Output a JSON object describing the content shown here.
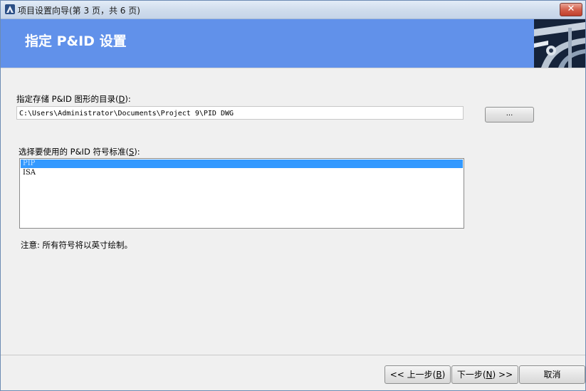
{
  "window": {
    "title": "项目设置向导(第 3 页，共 6 页)",
    "close_glyph": "✕"
  },
  "banner": {
    "heading": "指定 P&ID 设置"
  },
  "directory": {
    "label": "指定存储 P&ID 图形的目录",
    "hotkey": "D",
    "value": "C:\\Users\\Administrator\\Documents\\Project 9\\PID DWG",
    "browse_label": "..."
  },
  "standard": {
    "label": "选择要使用的 P&ID 符号标准",
    "hotkey": "S",
    "options": [
      "PIP",
      "ISA"
    ],
    "selected": "PIP"
  },
  "note": "注意: 所有符号将以英寸绘制。",
  "buttons": {
    "back_label": "<< 上一步",
    "back_hotkey": "B",
    "next_label": "下一步",
    "next_hotkey": "N",
    "next_suffix": ">>",
    "cancel_label": "取消"
  },
  "colors": {
    "banner": "#6191ea",
    "selection": "#3399ff"
  }
}
